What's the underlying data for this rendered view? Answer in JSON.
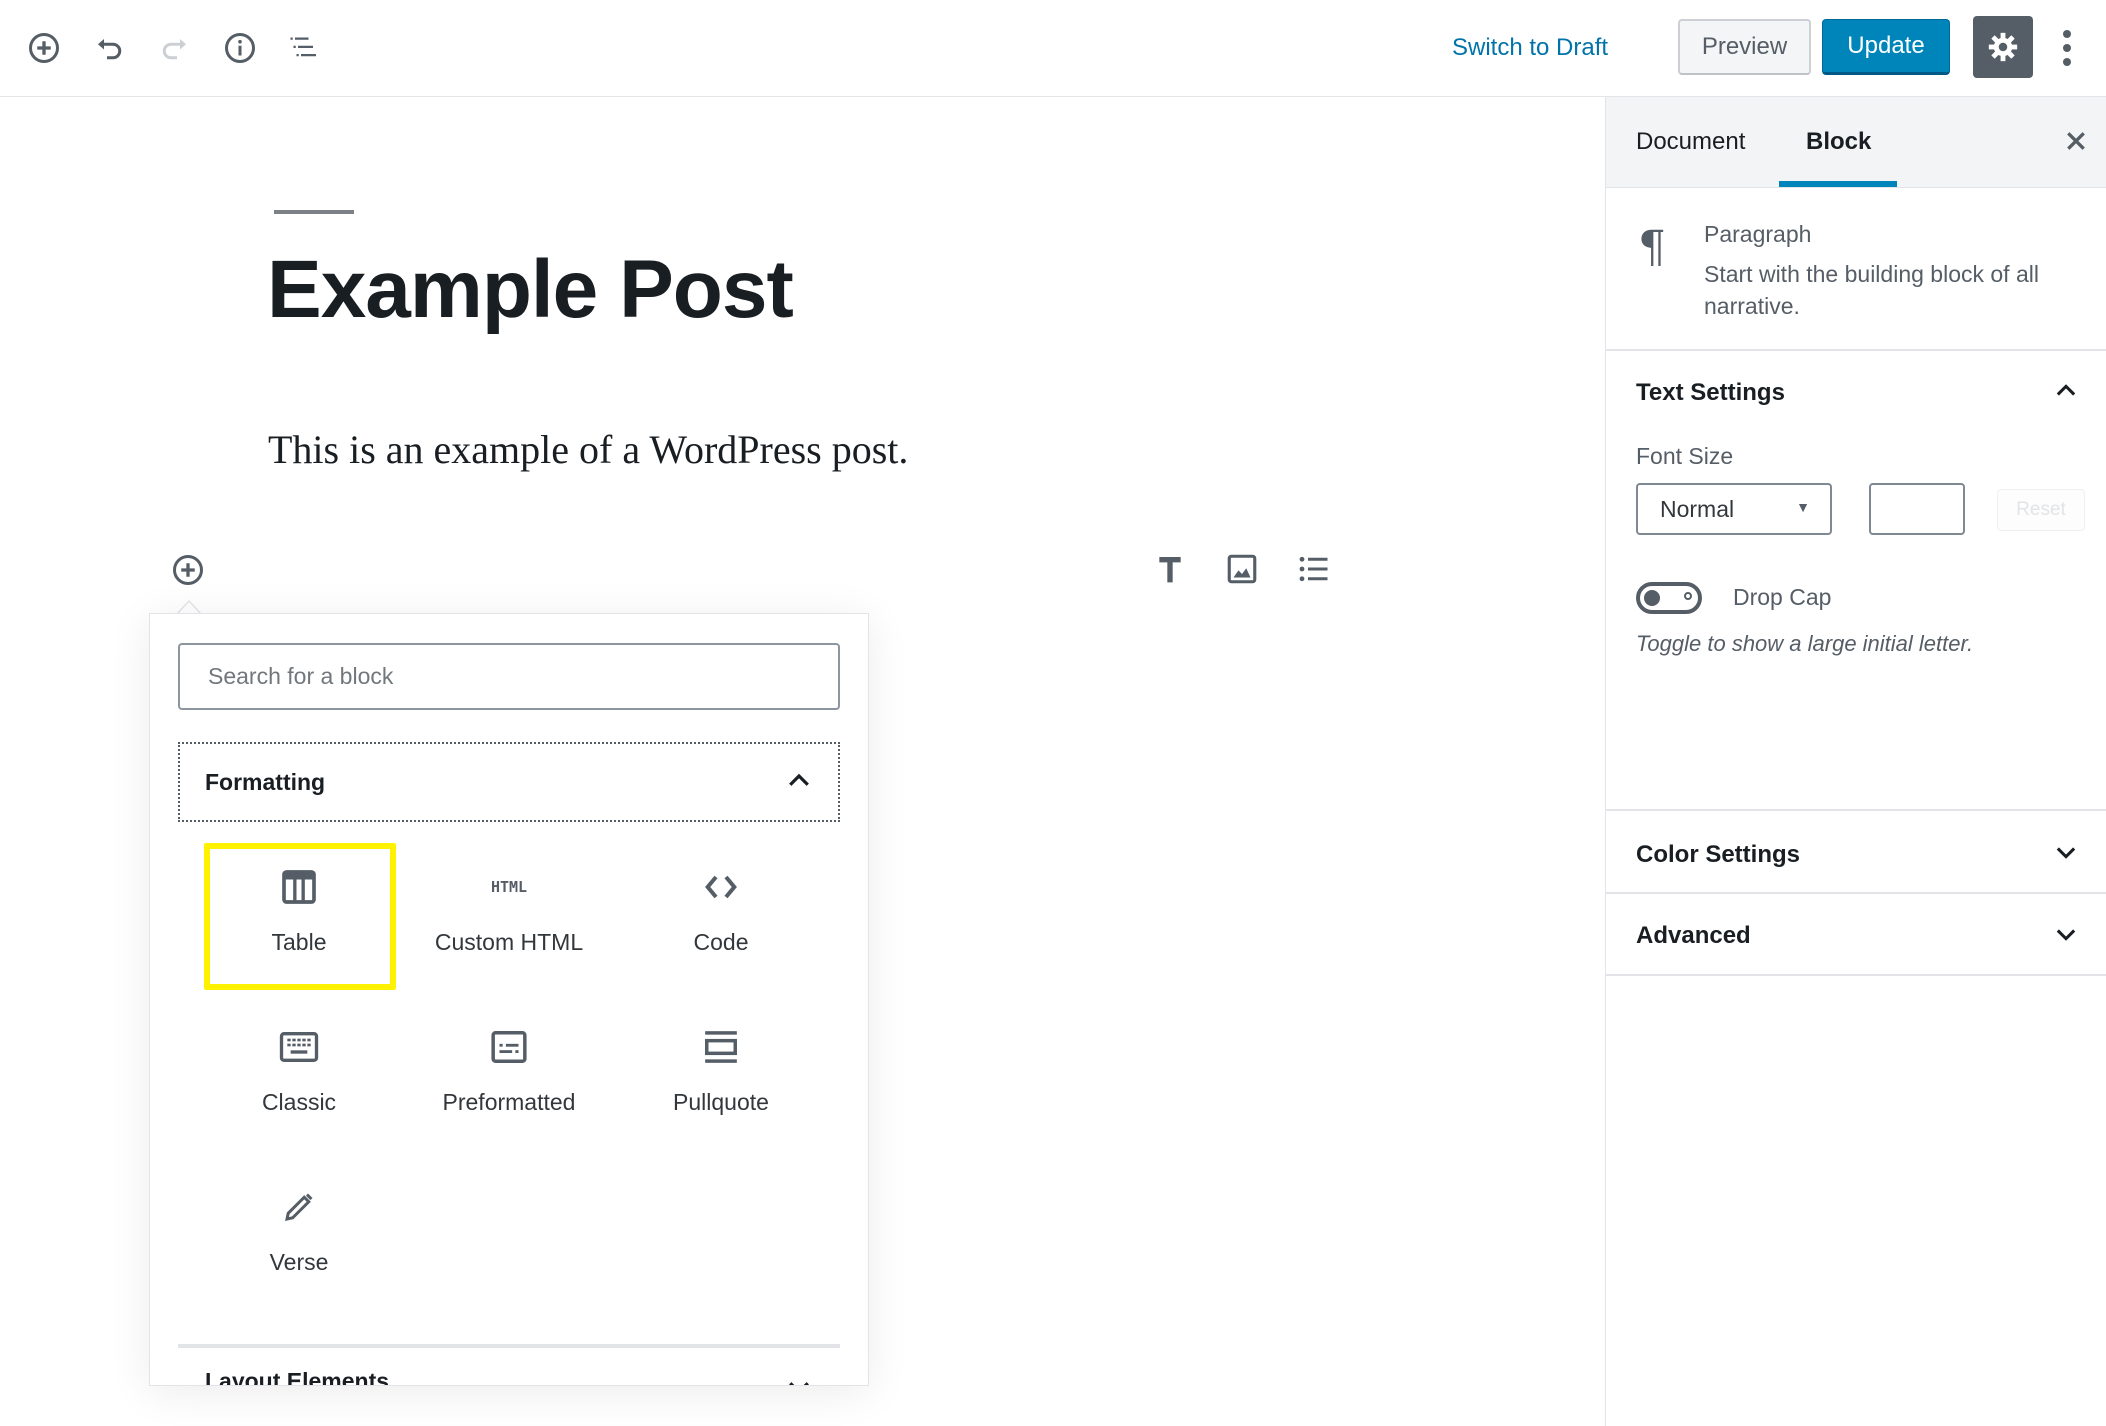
{
  "header": {
    "icons": {
      "add_block": "plus-circle-icon",
      "undo": "undo-icon",
      "redo": "redo-icon",
      "info": "info-icon",
      "outline": "list-outline-icon"
    },
    "switch_to_draft": "Switch to Draft",
    "preview": "Preview",
    "update": "Update",
    "settings_icon": "gear-icon",
    "more_icon": "vertical-ellipsis-icon"
  },
  "colors": {
    "accent": "#0085ba",
    "link": "#0073aa",
    "icon": "#555d66",
    "highlight": "#fff200"
  },
  "editor": {
    "title": "Example Post",
    "paragraph": "This is an example of a WordPress post.",
    "quick_inserts": [
      "heading-icon",
      "image-icon",
      "list-icon"
    ]
  },
  "inserter": {
    "search_placeholder": "Search for a block",
    "search_value": "",
    "sections": [
      {
        "title": "Formatting",
        "expanded": true,
        "items": [
          {
            "label": "Table",
            "icon": "table-icon",
            "highlighted": true
          },
          {
            "label": "Custom HTML",
            "icon": "html-icon"
          },
          {
            "label": "Code",
            "icon": "code-icon"
          },
          {
            "label": "Classic",
            "icon": "keyboard-icon"
          },
          {
            "label": "Preformatted",
            "icon": "preformatted-icon"
          },
          {
            "label": "Pullquote",
            "icon": "pullquote-icon"
          },
          {
            "label": "Verse",
            "icon": "pencil-icon"
          }
        ]
      },
      {
        "title": "Layout Elements",
        "expanded": false
      }
    ],
    "html_glyph": "HTML"
  },
  "sidebar": {
    "tabs": [
      {
        "label": "Document",
        "active": false
      },
      {
        "label": "Block",
        "active": true
      }
    ],
    "block": {
      "name": "Paragraph",
      "description": "Start with the building block of all narrative.",
      "icon_glyph": "¶"
    },
    "text_settings": {
      "title": "Text Settings",
      "expanded": true,
      "font_size_label": "Font Size",
      "font_size_value": "Normal",
      "custom_size_value": "",
      "reset_label": "Reset",
      "drop_cap_label": "Drop Cap",
      "drop_cap_enabled": false,
      "drop_cap_help": "Toggle to show a large initial letter."
    },
    "color_settings": {
      "title": "Color Settings",
      "expanded": false
    },
    "advanced": {
      "title": "Advanced",
      "expanded": false
    }
  }
}
